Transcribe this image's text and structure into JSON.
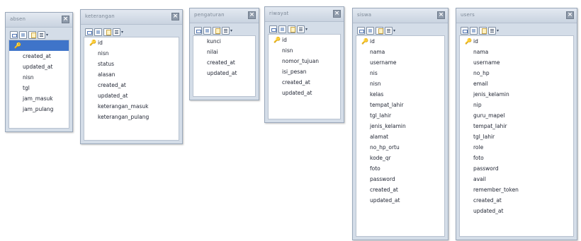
{
  "tables": [
    {
      "name": "absen",
      "fields": [
        "",
        "created_at",
        "updated_at",
        "nisn",
        "tgl",
        "jam_masuk",
        "jam_pulang"
      ],
      "selected": 0
    },
    {
      "name": "keterangan",
      "fields": [
        "id",
        "nisn",
        "status",
        "alasan",
        "created_at",
        "updated_at",
        "keterangan_masuk",
        "keterangan_pulang"
      ]
    },
    {
      "name": "pengaturan",
      "fields": [
        "kunci",
        "nilai",
        "created_at",
        "updated_at"
      ]
    },
    {
      "name": "riwayat",
      "fields": [
        "id",
        "nisn",
        "nomor_tujuan",
        "isi_pesan",
        "created_at",
        "updated_at"
      ]
    },
    {
      "name": "siswa",
      "fields": [
        "id",
        "nama",
        "username",
        "nis",
        "nisn",
        "kelas",
        "tempat_lahir",
        "tgl_lahir",
        "jenis_kelamin",
        "alamat",
        "no_hp_ortu",
        "kode_qr",
        "foto",
        "password",
        "created_at",
        "updated_at"
      ]
    },
    {
      "name": "users",
      "fields": [
        "id",
        "nama",
        "username",
        "no_hp",
        "email",
        "jenis_kelamin",
        "nip",
        "guru_mapel",
        "tempat_lahir",
        "tgl_lahir",
        "role",
        "foto",
        "password",
        "avail",
        "remember_token",
        "created_at",
        "updated_at"
      ]
    }
  ],
  "icons": {
    "close": "close-icon",
    "primary_key": "primary-key-icon",
    "toolbar": [
      "table-view-icon",
      "grid-view-icon",
      "multiple-tables-icon",
      "list-view-icon"
    ]
  },
  "colors": {
    "panel": "#d4dde8",
    "selection": "#3f74c9",
    "key": "#d0a21b"
  }
}
